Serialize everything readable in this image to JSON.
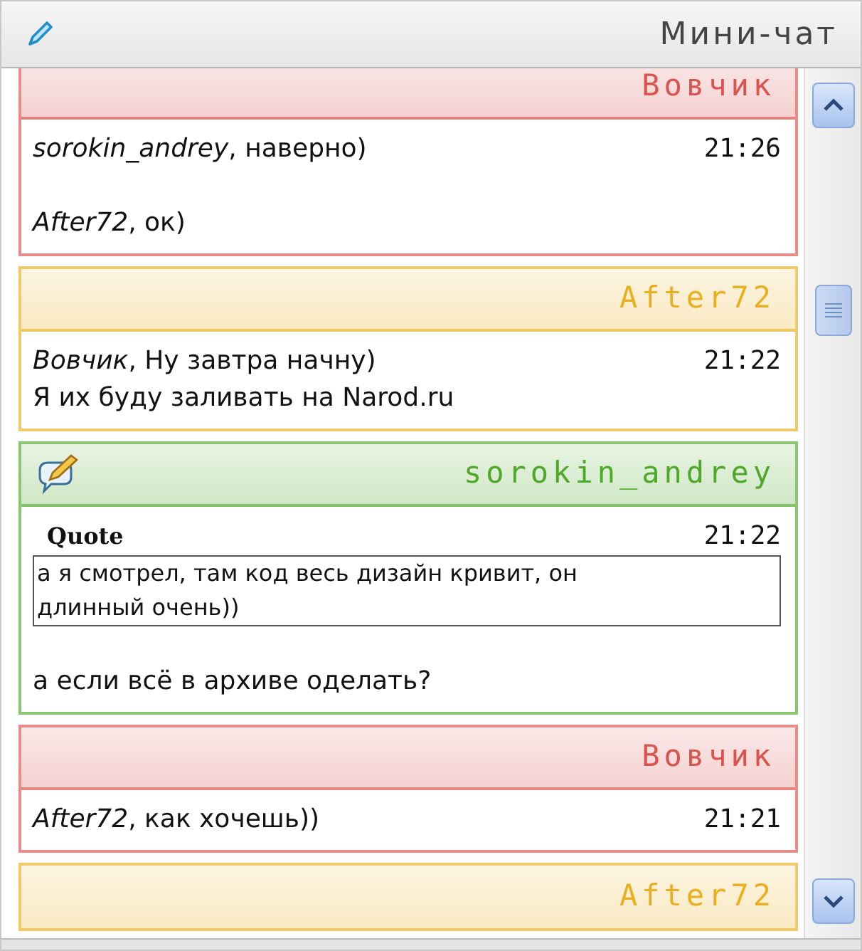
{
  "header": {
    "title": "Мини-чат"
  },
  "messages": [
    {
      "author": "Вовчик",
      "color": "#d9534f",
      "time": "21:26",
      "paragraphs": [
        [
          "*sorokin_andrey*, наверно)"
        ],
        [
          "*After72*, ок)"
        ]
      ]
    },
    {
      "author": "After72",
      "color": "#e8b020",
      "time": "21:22",
      "paragraphs": [
        [
          "*Вовчик*, Ну завтра начну)",
          "Я их буду заливать на Narod.ru"
        ]
      ]
    },
    {
      "author": "sorokin_andrey",
      "color": "#4fa82a",
      "time": "21:22",
      "has_icon": true,
      "quote": {
        "label": "Quote",
        "text": "а я смотрел, там код весь дизайн кривит, он длинный очень))"
      },
      "paragraphs": [
        [
          "а если всё в архиве оделать?"
        ]
      ]
    },
    {
      "author": "Вовчик",
      "color": "#d9534f",
      "time": "21:21",
      "paragraphs": [
        [
          "*After72*, как хочешь))"
        ]
      ]
    },
    {
      "author": "After72",
      "color": "#e8b020"
    }
  ]
}
